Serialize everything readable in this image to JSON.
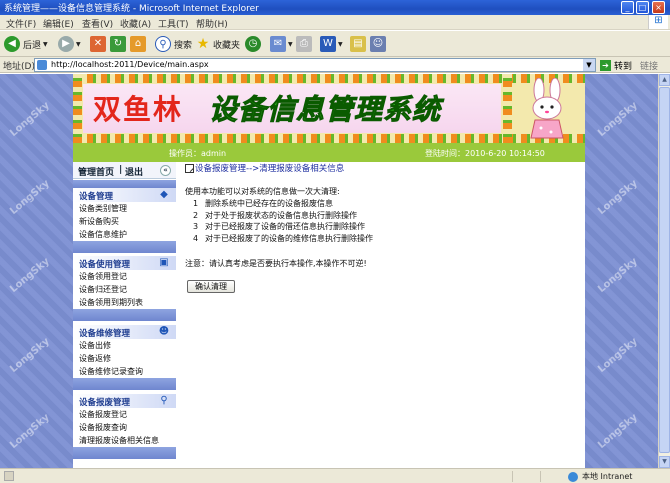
{
  "window": {
    "title": "系统管理——设备信息管理系统 - Microsoft Internet Explorer",
    "minimize": "_",
    "maximize": "□",
    "close": "×"
  },
  "menu": [
    "文件(F)",
    "编辑(E)",
    "查看(V)",
    "收藏(A)",
    "工具(T)",
    "帮助(H)"
  ],
  "toolbar": {
    "back": "后退",
    "search": "搜索",
    "favorites": "收藏夹"
  },
  "address": {
    "label": "地址(D)",
    "url": "http://localhost:2011/Device/main.aspx",
    "go": "转到",
    "links": "链接"
  },
  "banner": {
    "title_red": "双鱼林",
    "title_green": "设备信息管理系统"
  },
  "infobar": {
    "operator": "操作员：admin",
    "login_time": "登陆时间：2010-6-20 10:14:50"
  },
  "sidebar": {
    "home": "管理首页",
    "separator": "|",
    "logout": "退出",
    "collapse": "«",
    "groups": [
      {
        "title": "设备管理",
        "icon": "device-icon",
        "items": [
          "设备类别管理",
          "新设备购买",
          "设备信息维护"
        ]
      },
      {
        "title": "设备使用管理",
        "icon": "usage-icon",
        "items": [
          "设备领用登记",
          "设备归还登记",
          "设备领用到期列表"
        ]
      },
      {
        "title": "设备维修管理",
        "icon": "repair-icon",
        "items": [
          "设备出修",
          "设备返修",
          "设备维修记录查询"
        ]
      },
      {
        "title": "设备报废管理",
        "icon": "scrap-search-icon",
        "items": [
          "设备报废登记",
          "设备报废查询",
          "清理报废设备相关信息"
        ]
      }
    ]
  },
  "main": {
    "breadcrumb": "设备报废管理-->清理报废设备相关信息",
    "description": "使用本功能可以对系统的信息做一次大清理:",
    "steps": [
      {
        "n": "1",
        "text": "删除系统中已经存在的设备报废信息"
      },
      {
        "n": "2",
        "text": "对于处于报废状态的设备信息执行删除操作"
      },
      {
        "n": "3",
        "text": "对于已经报废了设备的借还信息执行删除操作"
      },
      {
        "n": "4",
        "text": "对于已经报废了的设备的维修信息执行删除操作"
      }
    ],
    "note": "注意：请认真考虑是否要执行本操作,本操作不可逆!",
    "confirm_button": "确认清理"
  },
  "watermark": "LongSky",
  "status": {
    "zone": "本地 Intranet"
  }
}
